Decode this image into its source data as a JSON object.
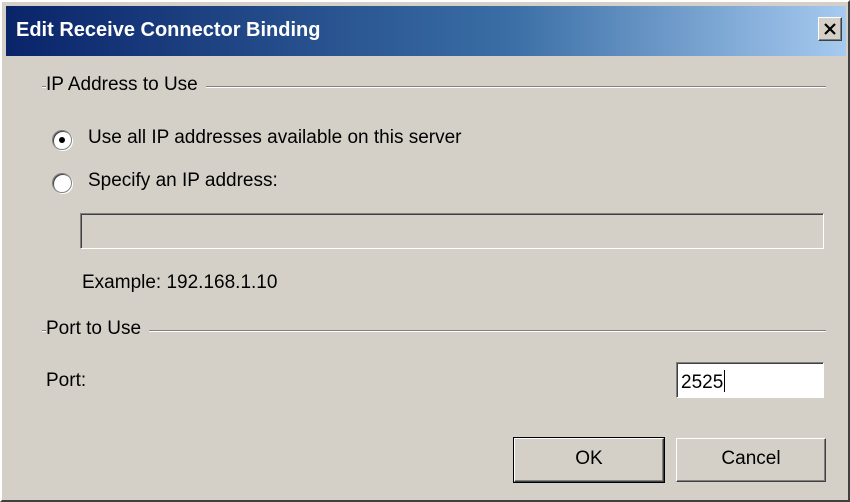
{
  "dialog": {
    "title": "Edit Receive Connector Binding",
    "close_icon": "close-icon"
  },
  "ip_group": {
    "label": "IP Address to Use",
    "options": [
      {
        "label": "Use all IP addresses available on this server",
        "selected": true
      },
      {
        "label": "Specify an IP address:",
        "selected": false
      }
    ],
    "ip_value": "",
    "ip_enabled": false,
    "example": "Example: 192.168.1.10"
  },
  "port_group": {
    "label": "Port to Use",
    "port_label": "Port:",
    "port_value": "2525"
  },
  "buttons": {
    "ok": "OK",
    "cancel": "Cancel"
  },
  "colors": {
    "titlebar_start": "#0a246a",
    "titlebar_end": "#a6caf0",
    "face": "#d4d0c8"
  }
}
